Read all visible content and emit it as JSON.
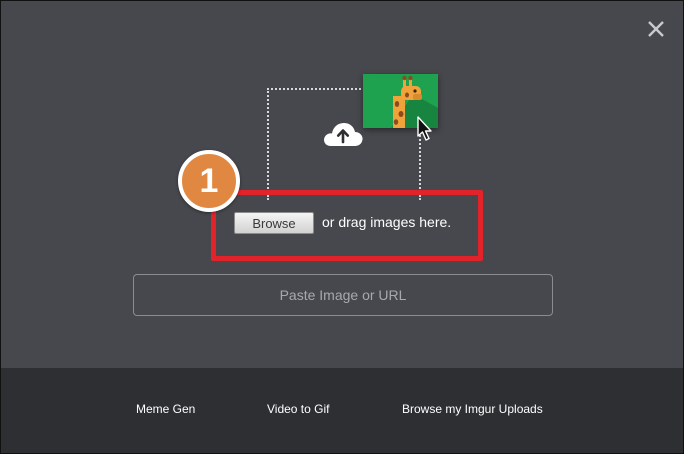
{
  "upload": {
    "browse_label": "Browse",
    "drag_text": "or drag images here.",
    "paste_placeholder": "Paste Image or URL"
  },
  "annotation": {
    "step_number": "1",
    "highlight_color": "#e2232a",
    "badge_color": "#e08841"
  },
  "footer": {
    "links": [
      {
        "label": "Meme Gen"
      },
      {
        "label": "Video to Gif"
      },
      {
        "label": "Browse my Imgur Uploads"
      }
    ]
  },
  "colors": {
    "dialog_bg": "#46484d",
    "footer_bg": "#2e2f33",
    "card_green": "#1fa24f"
  },
  "icons": [
    "close-icon",
    "cloud-upload-icon",
    "giraffe-image-icon",
    "mouse-cursor-icon"
  ]
}
